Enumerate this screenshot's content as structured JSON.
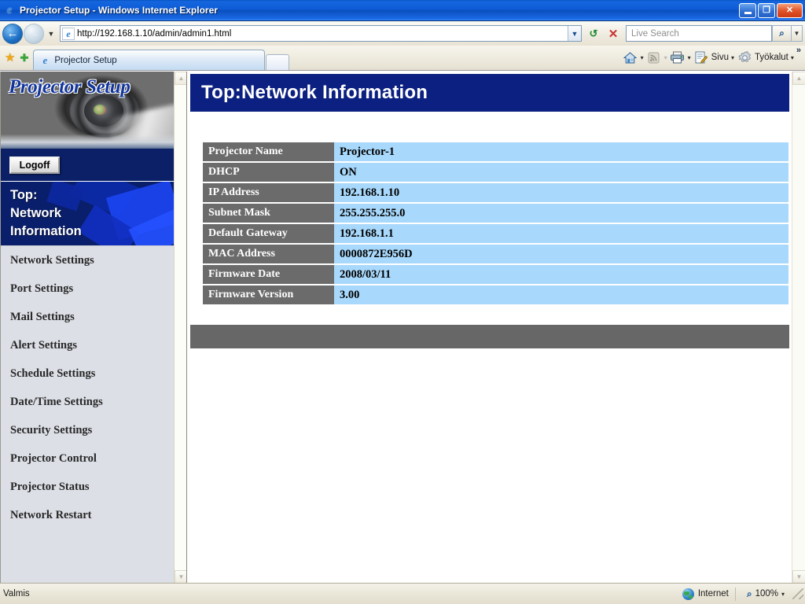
{
  "window": {
    "title": "Projector Setup - Windows Internet Explorer",
    "minimize_label": "–",
    "maximize_label": "❐",
    "close_label": "✕"
  },
  "nav": {
    "back_glyph": "←",
    "forward_glyph": "→",
    "history_caret": "▼",
    "url": "http://192.168.1.10/admin/admin1.html",
    "url_caret": "▼",
    "refresh_glyph": "↺",
    "stop_glyph": "✕",
    "search_placeholder": "Live Search",
    "search_go_glyph": "⌕",
    "search_caret": "▼"
  },
  "tabs": {
    "favorites_star": "★",
    "add_favorite": "✚",
    "items": [
      {
        "label": "Projector Setup",
        "active": true
      }
    ],
    "new_tab_label": ""
  },
  "command_bar": {
    "home": {
      "icon": "home-icon",
      "glyph": "⌂",
      "caret": "▾"
    },
    "feeds": {
      "icon": "rss-icon",
      "glyph": "◠",
      "caret": "▾"
    },
    "print": {
      "icon": "printer-icon",
      "glyph": "⎙",
      "caret": "▾"
    },
    "page": {
      "icon": "page-icon",
      "label": "Sivu",
      "caret": "▾"
    },
    "tools": {
      "icon": "gear-icon",
      "label": "Työkalut",
      "caret": "▾"
    },
    "overflow": "»"
  },
  "sidebar": {
    "brand": "Projector Setup",
    "logoff_label": "Logoff",
    "active_item": "Top:\nNetwork\nInformation",
    "active_item_lines": [
      "Top:",
      "Network",
      "Information"
    ],
    "items": [
      {
        "label": "Network Settings"
      },
      {
        "label": "Port Settings"
      },
      {
        "label": "Mail Settings"
      },
      {
        "label": "Alert Settings"
      },
      {
        "label": "Schedule Settings"
      },
      {
        "label": "Date/Time Settings"
      },
      {
        "label": "Security Settings"
      },
      {
        "label": "Projector Control"
      },
      {
        "label": "Projector Status"
      },
      {
        "label": "Network Restart"
      }
    ]
  },
  "content": {
    "page_title": "Top:Network Information",
    "rows": [
      {
        "label": "Projector Name",
        "value": "Projector-1"
      },
      {
        "label": "DHCP",
        "value": "ON"
      },
      {
        "label": "IP Address",
        "value": "192.168.1.10"
      },
      {
        "label": "Subnet Mask",
        "value": "255.255.255.0"
      },
      {
        "label": "Default Gateway",
        "value": "192.168.1.1"
      },
      {
        "label": "MAC Address",
        "value": "0000872E956D"
      },
      {
        "label": "Firmware Date",
        "value": "2008/03/11"
      },
      {
        "label": "Firmware Version",
        "value": "3.00"
      }
    ]
  },
  "statusbar": {
    "status_text": "Valmis",
    "zone_label": "Internet",
    "zoom_level": "100%",
    "zoom_caret": "▾"
  },
  "scrollbars": {
    "up_glyph": "▲",
    "down_glyph": "▼"
  },
  "colors": {
    "titlebar_blue": "#0d5bd6",
    "header_navy": "#0b2080",
    "label_gray": "#6b6b6b",
    "value_blue": "#a8d8fb",
    "brand_blue": "#12359b",
    "accent_bar_gray": "#676767"
  }
}
